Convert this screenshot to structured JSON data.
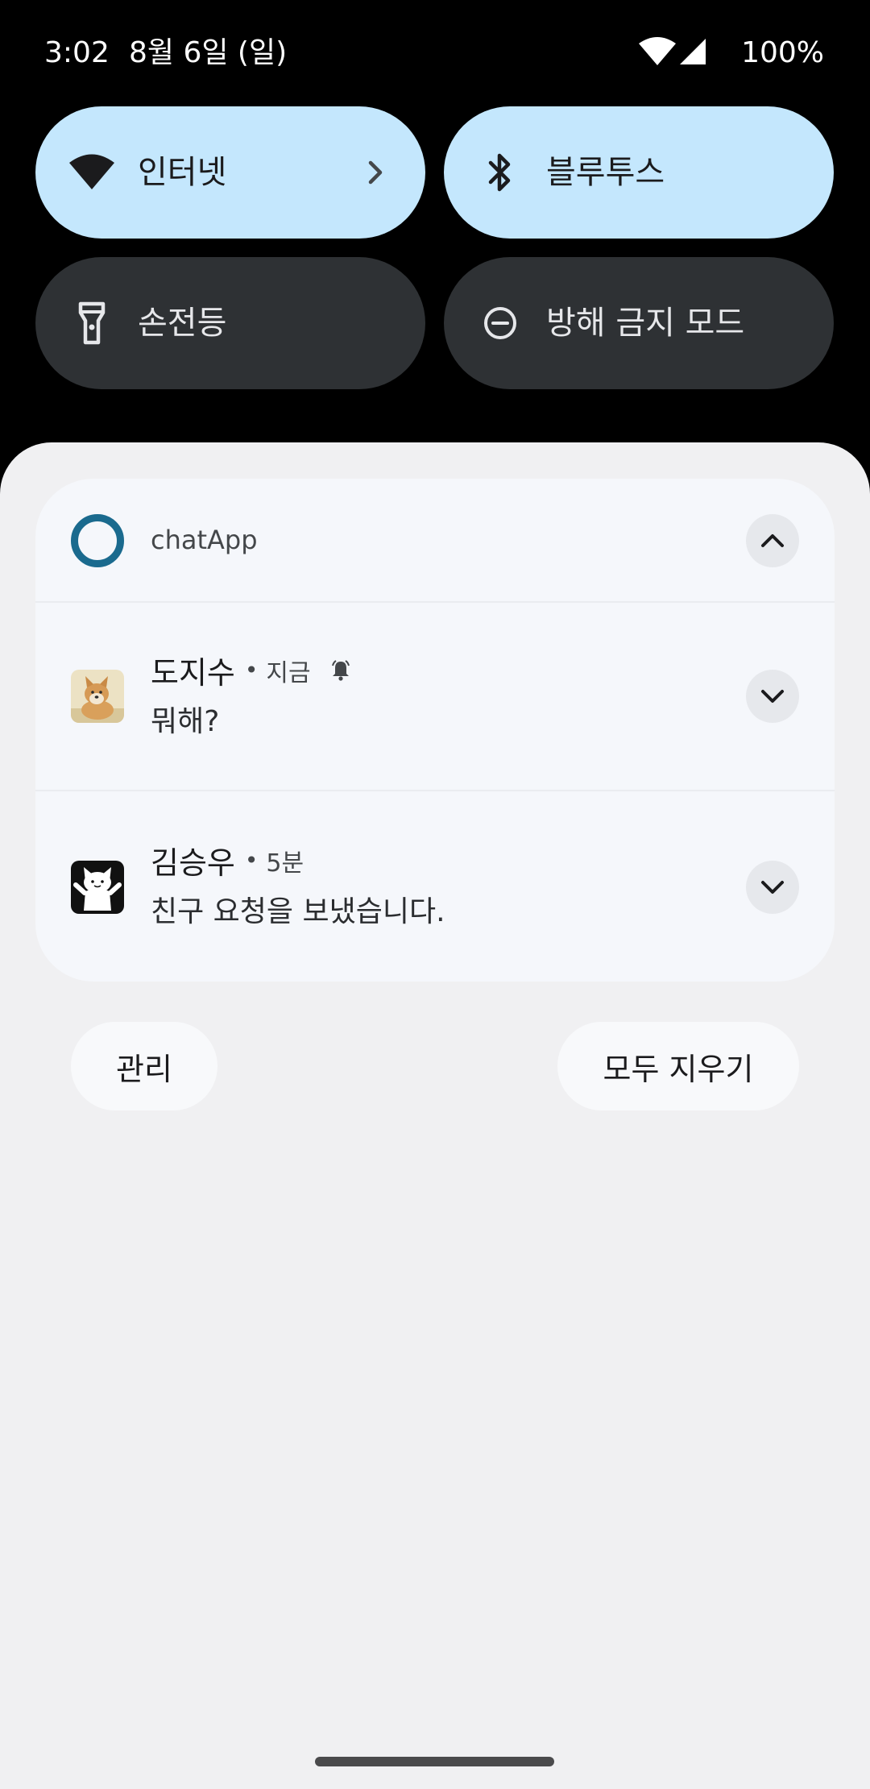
{
  "status_bar": {
    "time": "3:02",
    "date": "8월 6일 (일)",
    "battery": "100%",
    "icons": [
      "wifi-icon",
      "cell-signal-icon"
    ]
  },
  "quick_settings": {
    "tiles": [
      {
        "label": "인터넷",
        "icon": "wifi-icon",
        "state": "on",
        "has_chevron": true
      },
      {
        "label": "블루투스",
        "icon": "bluetooth-icon",
        "state": "on"
      },
      {
        "label": "손전등",
        "icon": "flashlight-icon",
        "state": "off"
      },
      {
        "label": "방해 금지 모드",
        "icon": "do-not-disturb-icon",
        "state": "off"
      }
    ]
  },
  "notification_group": {
    "app_name": "chatApp",
    "expanded": true,
    "notifications": [
      {
        "sender": "도지수",
        "separator": "•",
        "time": "지금",
        "message": "뭐해?",
        "alerting": true,
        "avatar": "shiba-dog-avatar"
      },
      {
        "sender": "김승우",
        "separator": "•",
        "time": "5분",
        "message": "친구 요청을 보냈습니다.",
        "alerting": false,
        "avatar": "white-cat-avatar"
      }
    ]
  },
  "actions": {
    "manage_label": "관리",
    "clear_all_label": "모두 지우기"
  },
  "colors": {
    "tile_on": "#c4e7fd",
    "tile_off": "#2e3134",
    "shade_background": "#f0f0f2",
    "card_background": "#f5f7fb",
    "app_icon_ring": "#1a6a8e"
  }
}
